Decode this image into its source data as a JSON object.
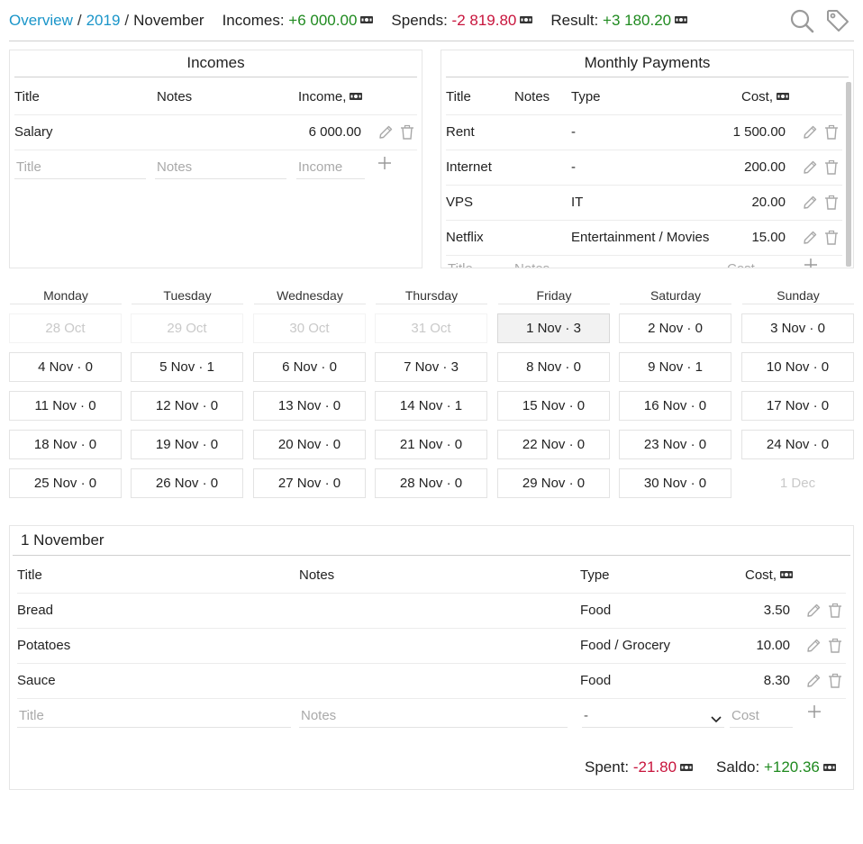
{
  "breadcrumb": {
    "overview": "Overview",
    "year": "2019",
    "month": "November",
    "sep": "/"
  },
  "summary": {
    "incomes_label": "Incomes:",
    "incomes_value": "+6 000.00",
    "spends_label": "Spends:",
    "spends_value": "-2 819.80",
    "result_label": "Result:",
    "result_value": "+3 180.20"
  },
  "header_icons": [
    "search-icon",
    "tag-icon"
  ],
  "incomes": {
    "title": "Incomes",
    "columns": {
      "title": "Title",
      "notes": "Notes",
      "income": "Income,"
    },
    "rows": [
      {
        "title": "Salary",
        "notes": "",
        "income": "6 000.00"
      }
    ],
    "new_row": {
      "title_placeholder": "Title",
      "notes_placeholder": "Notes",
      "income_placeholder": "Income"
    }
  },
  "monthly_payments": {
    "title": "Monthly Payments",
    "columns": {
      "title": "Title",
      "notes": "Notes",
      "type": "Type",
      "cost": "Cost,"
    },
    "rows": [
      {
        "title": "Rent",
        "notes": "",
        "type": "-",
        "cost": "1 500.00"
      },
      {
        "title": "Internet",
        "notes": "",
        "type": "-",
        "cost": "200.00"
      },
      {
        "title": "VPS",
        "notes": "",
        "type": "IT",
        "cost": "20.00"
      },
      {
        "title": "Netflix",
        "notes": "",
        "type": "Entertainment / Movies",
        "cost": "15.00"
      }
    ],
    "new_row": {
      "title_placeholder": "Title",
      "notes_placeholder": "Notes",
      "cost_placeholder": "Cost"
    }
  },
  "calendar": {
    "weekdays": [
      "Monday",
      "Tuesday",
      "Wednesday",
      "Thursday",
      "Friday",
      "Saturday",
      "Sunday"
    ],
    "weeks": [
      [
        "28 Oct",
        "29 Oct",
        "30 Oct",
        "31 Oct",
        "1 Nov · 3",
        "2 Nov · 0",
        "3 Nov · 0"
      ],
      [
        "4 Nov · 0",
        "5 Nov · 1",
        "6 Nov · 0",
        "7 Nov · 3",
        "8 Nov · 0",
        "9 Nov · 1",
        "10 Nov · 0"
      ],
      [
        "11 Nov · 0",
        "12 Nov · 0",
        "13 Nov · 0",
        "14 Nov · 1",
        "15 Nov · 0",
        "16 Nov · 0",
        "17 Nov · 0"
      ],
      [
        "18 Nov · 0",
        "19 Nov · 0",
        "20 Nov · 0",
        "21 Nov · 0",
        "22 Nov · 0",
        "23 Nov · 0",
        "24 Nov · 0"
      ],
      [
        "25 Nov · 0",
        "26 Nov · 0",
        "27 Nov · 0",
        "28 Nov · 0",
        "29 Nov · 0",
        "30 Nov · 0",
        "1 Dec"
      ]
    ],
    "selected": "1 Nov · 3"
  },
  "day": {
    "title": "1 November",
    "columns": {
      "title": "Title",
      "notes": "Notes",
      "type": "Type",
      "cost": "Cost,"
    },
    "rows": [
      {
        "title": "Bread",
        "notes": "",
        "type": "Food",
        "cost": "3.50"
      },
      {
        "title": "Potatoes",
        "notes": "",
        "type": "Food / Grocery",
        "cost": "10.00"
      },
      {
        "title": "Sauce",
        "notes": "",
        "type": "Food",
        "cost": "8.30"
      }
    ],
    "new_row": {
      "title_placeholder": "Title",
      "notes_placeholder": "Notes",
      "type_selected": "-",
      "cost_placeholder": "Cost"
    },
    "spent_label": "Spent:",
    "spent_value": "-21.80",
    "saldo_label": "Saldo:",
    "saldo_value": "+120.36"
  },
  "colors": {
    "link": "#1a95c9",
    "positive": "#1f8a1f",
    "negative": "#c8143c"
  }
}
